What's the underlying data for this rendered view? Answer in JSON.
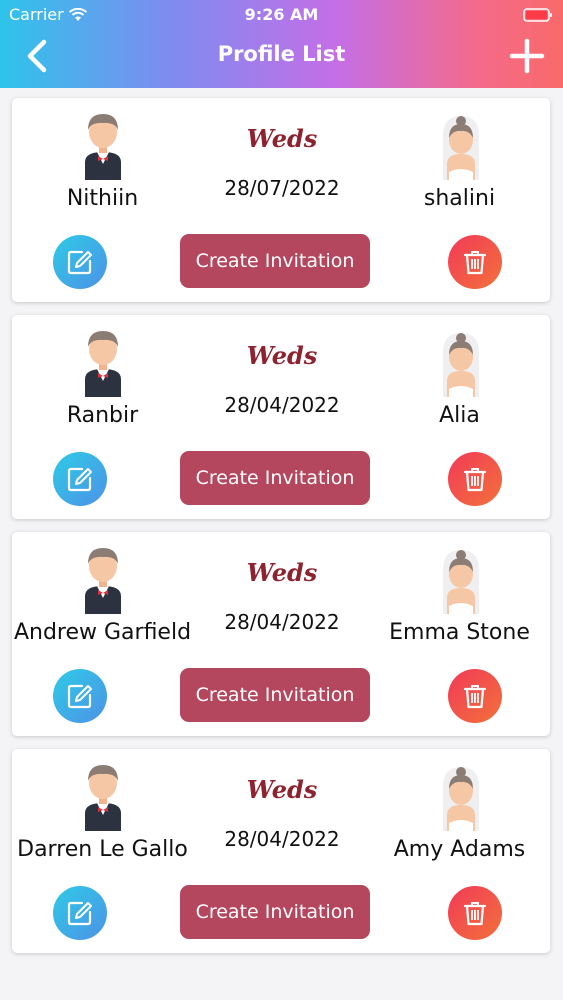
{
  "status_bar": {
    "carrier": "Carrier",
    "time": "9:26 AM"
  },
  "header": {
    "title": "Profile List",
    "back_icon": "chevron-left-icon",
    "add_icon": "plus-icon"
  },
  "colors": {
    "header_gradient": [
      "#2ec4ea",
      "#c56ee6",
      "#f96a6a"
    ],
    "invite_button": "#b4465d",
    "weds_text": "#8e2330"
  },
  "profiles": [
    {
      "groom": "Nithiin",
      "bride": "shalini",
      "weds": "Weds",
      "date": "28/07/2022",
      "invite_label": "Create Invitation"
    },
    {
      "groom": "Ranbir",
      "bride": "Alia",
      "weds": "Weds",
      "date": "28/04/2022",
      "invite_label": "Create Invitation"
    },
    {
      "groom": "Andrew Garfield",
      "bride": "Emma Stone",
      "weds": "Weds",
      "date": "28/04/2022",
      "invite_label": "Create Invitation"
    },
    {
      "groom": "Darren Le Gallo",
      "bride": "Amy Adams",
      "weds": "Weds",
      "date": "28/04/2022",
      "invite_label": "Create Invitation"
    }
  ]
}
